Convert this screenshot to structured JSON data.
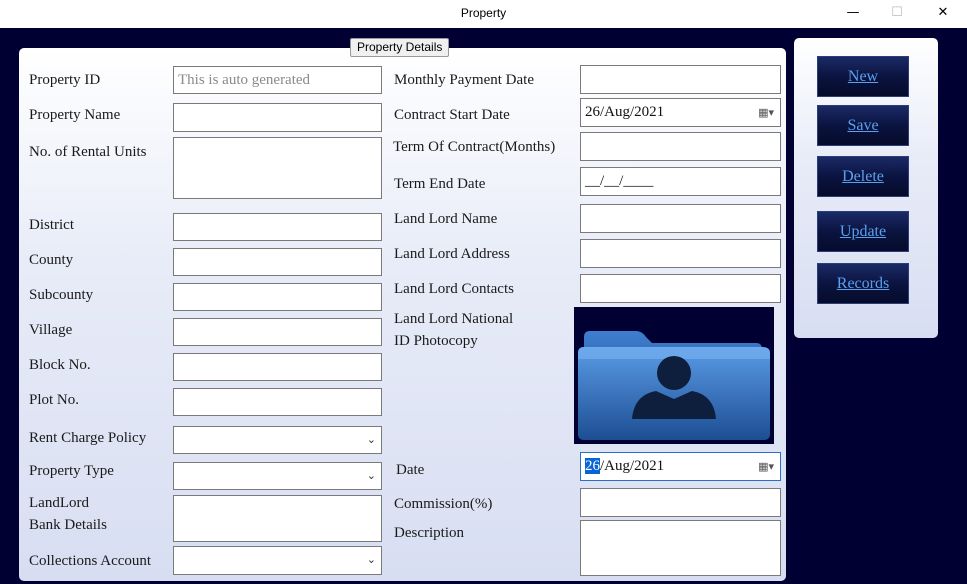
{
  "window": {
    "title": "Property",
    "minimize": "—",
    "maximize": "☐",
    "close": "✕"
  },
  "group_title": "Property Details",
  "left": {
    "property_id_label": "Property ID",
    "property_id_placeholder": "This is auto generated",
    "property_name_label": "Property Name",
    "rental_units_label": "No. of Rental Units",
    "district_label": "District",
    "county_label": "County",
    "subcounty_label": "Subcounty",
    "village_label": "Village",
    "block_label": "Block No.",
    "plot_label": "Plot No.",
    "rent_policy_label": "Rent Charge Policy",
    "property_type_label": "Property Type",
    "bank_label_1": "LandLord",
    "bank_label_2": "Bank Details",
    "collections_label": "Collections Account"
  },
  "right": {
    "monthly_payment_label": "Monthly Payment Date",
    "contract_start_label": "Contract Start Date",
    "contract_start_value": "26/Aug/2021",
    "term_label": "Term Of Contract(Months)",
    "term_end_label": "Term End Date",
    "term_end_value": "__/__/____",
    "landlord_name_label": "Land Lord Name",
    "landlord_address_label": "Land Lord Address",
    "landlord_contacts_label": "Land Lord Contacts",
    "national_id_label_1": "Land Lord National",
    "national_id_label_2": "ID Photocopy",
    "date_label": "Date",
    "date_day": "26",
    "date_rest": "/Aug/2021",
    "commission_label": "Commission(%)",
    "description_label": "Description"
  },
  "buttons": {
    "new": "New",
    "save": "Save",
    "delete": "Delete",
    "update": "Update",
    "records": "Records"
  },
  "icons": {
    "dropdown": "chevron-down-icon",
    "calendar": "calendar-icon",
    "photo": "user-folder-icon"
  }
}
